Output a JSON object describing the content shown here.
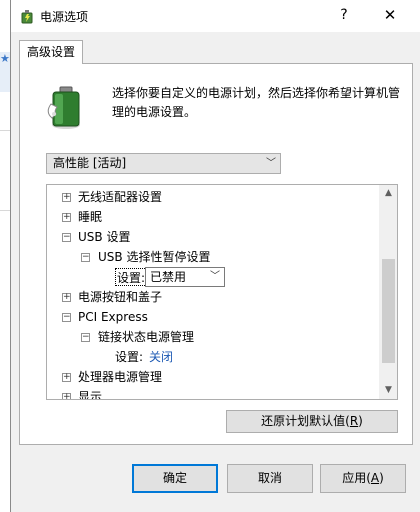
{
  "window": {
    "title": "电源选项",
    "help_glyph": "?",
    "close_glyph": "✕"
  },
  "tabs": [
    {
      "label": "高级设置"
    }
  ],
  "description": "选择你要自定义的电源计划，然后选择你希望计算机管理的电源设置。",
  "plan_dropdown": {
    "selected": "高性能 [活动]"
  },
  "tree": {
    "items": [
      {
        "expander": "+",
        "label": "无线适配器设置"
      },
      {
        "expander": "+",
        "label": "睡眠"
      },
      {
        "expander": "−",
        "label": "USB 设置"
      },
      {
        "expander": "−",
        "label": "USB 选择性暂停设置"
      },
      {
        "setting_label": "设置:",
        "setting_value": "已禁用"
      },
      {
        "expander": "+",
        "label": "电源按钮和盖子"
      },
      {
        "expander": "−",
        "label": "PCI Express"
      },
      {
        "expander": "−",
        "label": "链接状态电源管理"
      },
      {
        "setting_label": "设置:",
        "setting_value": "关闭"
      },
      {
        "expander": "+",
        "label": "处理器电源管理"
      },
      {
        "expander": "+",
        "label": "显示"
      }
    ]
  },
  "buttons": {
    "restore_defaults": {
      "text": "还原计划默认值(",
      "mnemonic": "R",
      "suffix": ")"
    },
    "ok": "确定",
    "cancel": "取消",
    "apply": {
      "text": "应用(",
      "mnemonic": "A",
      "suffix": ")"
    }
  },
  "colors": {
    "accent": "#0078d7",
    "link": "#1e5ab4"
  }
}
